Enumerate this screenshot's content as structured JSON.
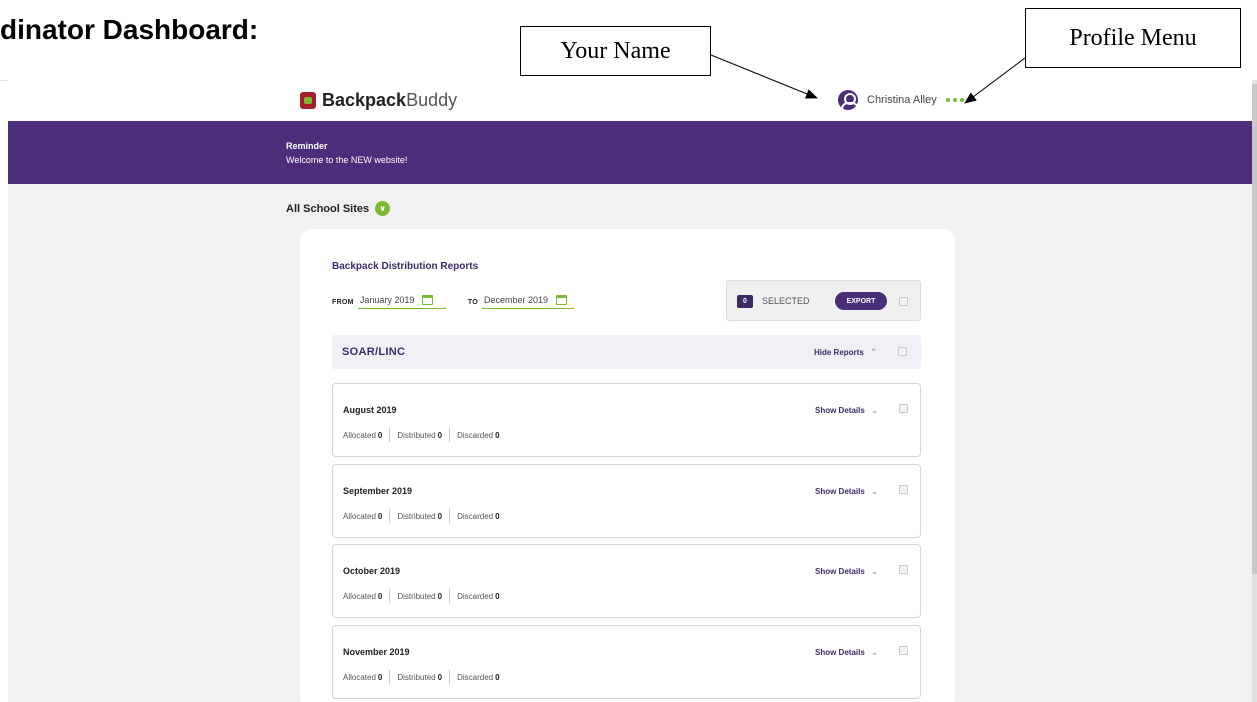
{
  "document": {
    "heading": "dinator Dashboard:",
    "callouts": {
      "your_name": "Your Name",
      "profile_menu": "Profile Menu"
    }
  },
  "header": {
    "logo_bold": "Backpack",
    "logo_light": "Buddy",
    "user_name": "Christina Alley",
    "icons": {
      "avatar": "user-circle-icon",
      "menu": "ellipsis-icon"
    }
  },
  "banner": {
    "title": "Reminder",
    "message": "Welcome to the NEW website!"
  },
  "sites": {
    "label": "All School Sites",
    "toggle_icon": "chevron-down-icon"
  },
  "reports": {
    "title": "Backpack Distribution Reports",
    "from_label": "FROM",
    "from_value": "January 2019",
    "to_label": "TO",
    "to_value": "December 2019",
    "selected_count": "0",
    "selected_label": "SELECTED",
    "export_label": "EXPORT",
    "school": {
      "name": "SOAR/LINC",
      "hide_label": "Hide Reports"
    },
    "stat_labels": {
      "allocated": "Allocated",
      "distributed": "Distributed",
      "discarded": "Discarded"
    },
    "show_details_label": "Show Details",
    "months": [
      {
        "name": "August 2019",
        "allocated": "0",
        "distributed": "0",
        "discarded": "0"
      },
      {
        "name": "September 2019",
        "allocated": "0",
        "distributed": "0",
        "discarded": "0"
      },
      {
        "name": "October 2019",
        "allocated": "0",
        "distributed": "0",
        "discarded": "0"
      },
      {
        "name": "November 2019",
        "allocated": "0",
        "distributed": "0",
        "discarded": "0"
      }
    ]
  },
  "colors": {
    "brand_purple": "#4a2e7a",
    "accent_green": "#7cba33",
    "logo_red": "#a51f2d"
  }
}
